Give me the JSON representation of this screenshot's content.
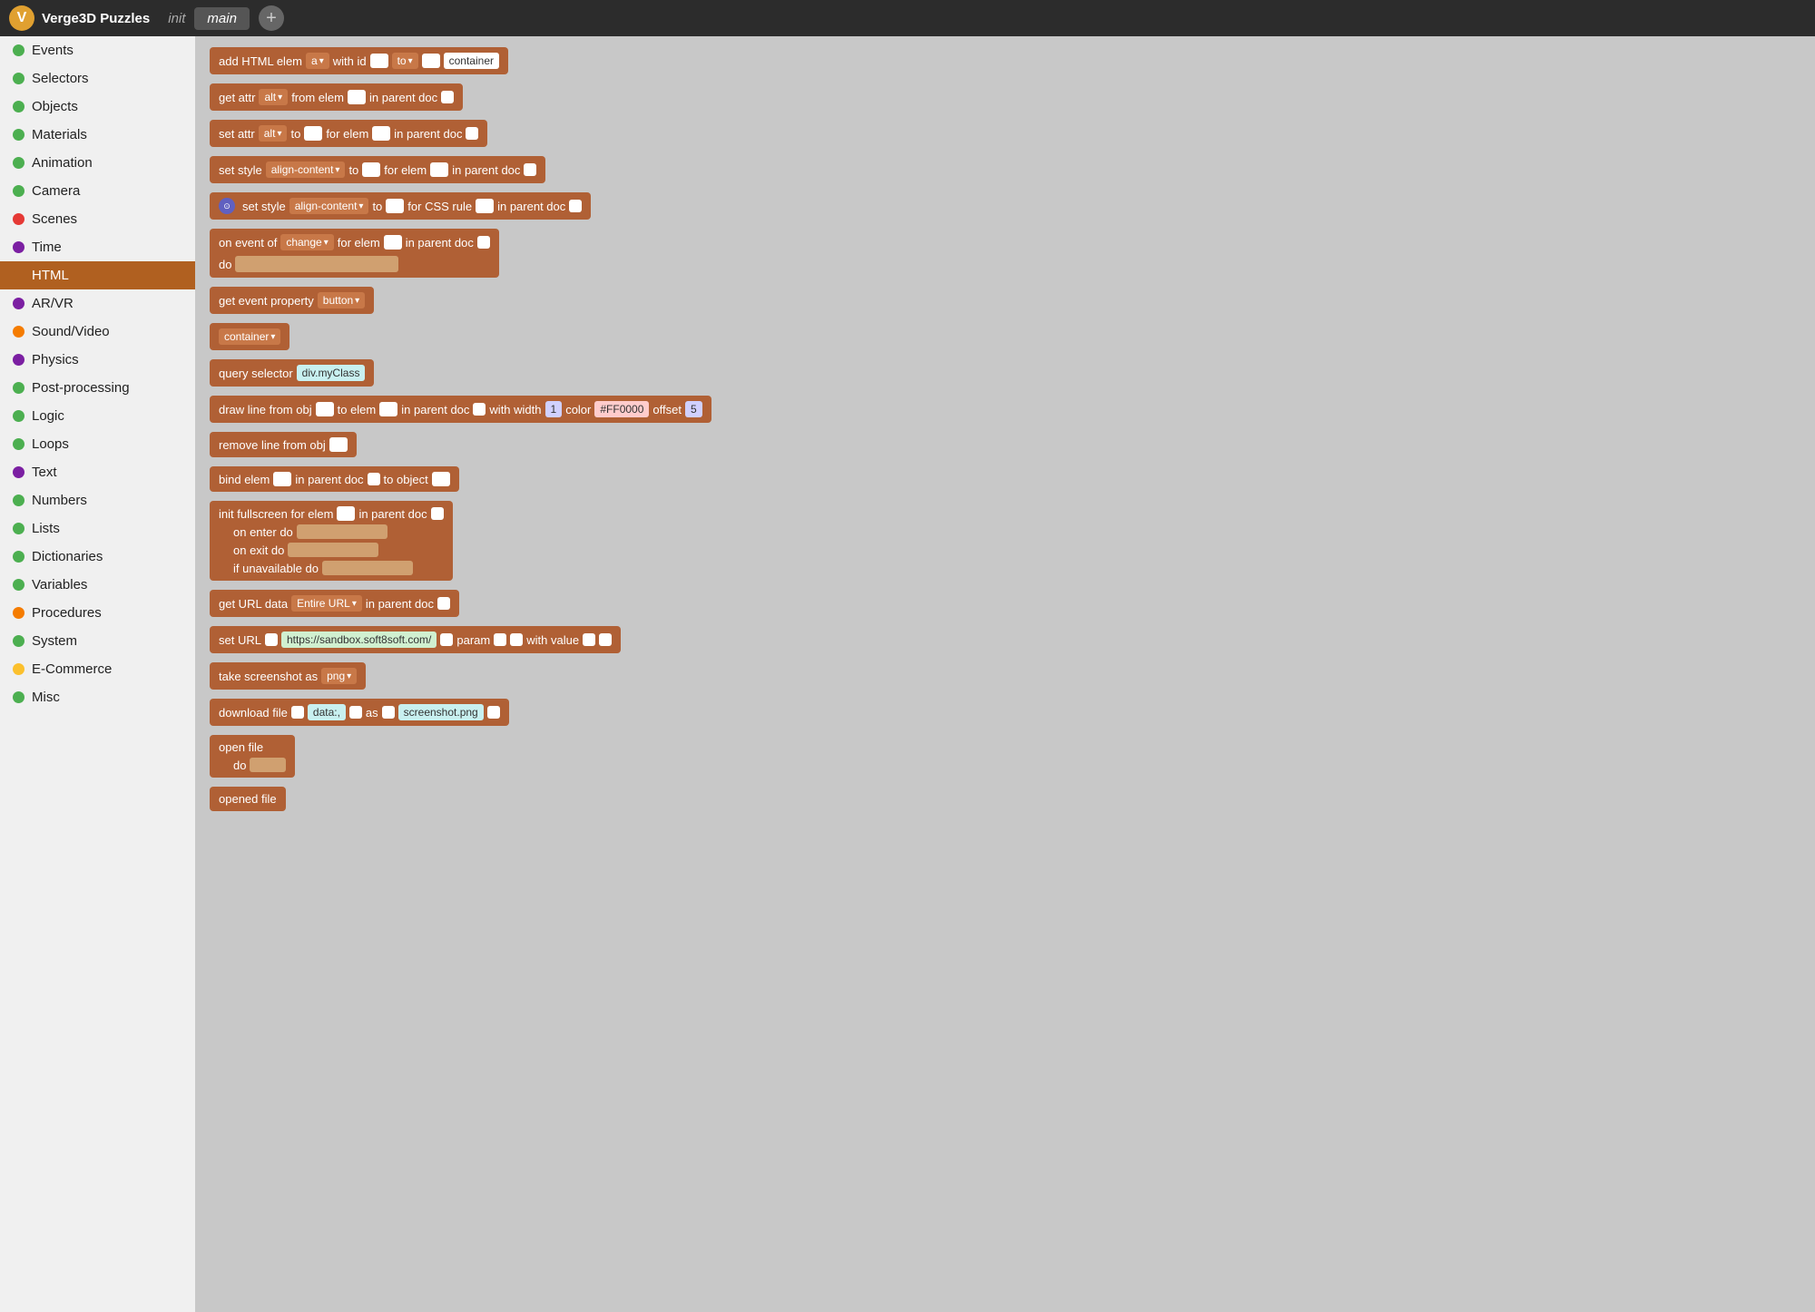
{
  "topbar": {
    "logo_icon": "V",
    "app_name": "Verge3D Puzzles",
    "tab_init": "init",
    "tab_main": "main",
    "add_tab_label": "+"
  },
  "sidebar": {
    "items": [
      {
        "id": "events",
        "label": "Events",
        "color": "#4caf50",
        "active": false
      },
      {
        "id": "selectors",
        "label": "Selectors",
        "color": "#4caf50",
        "active": false
      },
      {
        "id": "objects",
        "label": "Objects",
        "color": "#4caf50",
        "active": false
      },
      {
        "id": "materials",
        "label": "Materials",
        "color": "#4caf50",
        "active": false
      },
      {
        "id": "animation",
        "label": "Animation",
        "color": "#4caf50",
        "active": false
      },
      {
        "id": "camera",
        "label": "Camera",
        "color": "#4caf50",
        "active": false
      },
      {
        "id": "scenes",
        "label": "Scenes",
        "color": "#e53935",
        "active": false
      },
      {
        "id": "time",
        "label": "Time",
        "color": "#7b1fa2",
        "active": false
      },
      {
        "id": "html",
        "label": "HTML",
        "color": "#b06020",
        "active": true
      },
      {
        "id": "arvr",
        "label": "AR/VR",
        "color": "#7b1fa2",
        "active": false
      },
      {
        "id": "sound-video",
        "label": "Sound/Video",
        "color": "#f57c00",
        "active": false
      },
      {
        "id": "physics",
        "label": "Physics",
        "color": "#7b1fa2",
        "active": false
      },
      {
        "id": "post-processing",
        "label": "Post-processing",
        "color": "#4caf50",
        "active": false
      },
      {
        "id": "logic",
        "label": "Logic",
        "color": "#4caf50",
        "active": false
      },
      {
        "id": "loops",
        "label": "Loops",
        "color": "#4caf50",
        "active": false
      },
      {
        "id": "text",
        "label": "Text",
        "color": "#7b1fa2",
        "active": false
      },
      {
        "id": "numbers",
        "label": "Numbers",
        "color": "#4caf50",
        "active": false
      },
      {
        "id": "lists",
        "label": "Lists",
        "color": "#4caf50",
        "active": false
      },
      {
        "id": "dictionaries",
        "label": "Dictionaries",
        "color": "#4caf50",
        "active": false
      },
      {
        "id": "variables",
        "label": "Variables",
        "color": "#4caf50",
        "active": false
      },
      {
        "id": "procedures",
        "label": "Procedures",
        "color": "#f57c00",
        "active": false
      },
      {
        "id": "system",
        "label": "System",
        "color": "#4caf50",
        "active": false
      },
      {
        "id": "e-commerce",
        "label": "E-Commerce",
        "color": "#fbc02d",
        "active": false
      },
      {
        "id": "misc",
        "label": "Misc",
        "color": "#4caf50",
        "active": false
      }
    ]
  },
  "blocks": {
    "b1": "add HTML elem",
    "b1_drop": "a",
    "b1_text1": "with id",
    "b1_drop2": "to",
    "b1_input": "container",
    "b2": "get attr",
    "b2_drop": "alt",
    "b2_text1": "from elem",
    "b2_text2": "in parent doc",
    "b3": "set attr",
    "b3_drop": "alt",
    "b3_text1": "to",
    "b3_text2": "for elem",
    "b3_text3": "in parent doc",
    "b4": "set style",
    "b4_drop": "align-content",
    "b4_text1": "to",
    "b4_text2": "for elem",
    "b4_text3": "in parent doc",
    "b5": "set style",
    "b5_drop": "align-content",
    "b5_text1": "to",
    "b5_text2": "for CSS rule",
    "b5_text3": "in parent doc",
    "b6": "on event of",
    "b6_drop": "change",
    "b6_text1": "for elem",
    "b6_text2": "in parent doc",
    "b6_do": "do",
    "b7": "get event property",
    "b7_drop": "button",
    "b8_label": "container",
    "b9": "query selector",
    "b9_input": "div.myClass",
    "b10": "draw line from obj",
    "b10_text1": "to elem",
    "b10_text2": "in parent doc",
    "b10_text3": "with width",
    "b10_num": "1",
    "b10_text4": "color",
    "b10_color": "#FF0000",
    "b10_text5": "offset",
    "b10_offset": "5",
    "b11": "remove line from obj",
    "b12": "bind elem",
    "b12_text1": "in parent doc",
    "b12_text2": "to object",
    "b13": "init fullscreen for elem",
    "b13_text1": "in parent doc",
    "b13_enter": "on enter do",
    "b13_exit": "on exit do",
    "b13_unavail": "if unavailable do",
    "b14": "get URL data",
    "b14_drop": "Entire URL",
    "b14_text1": "in parent doc",
    "b15": "set URL",
    "b15_url": "https://sandbox.soft8soft.com/",
    "b15_text1": "param",
    "b15_text2": "with value",
    "b16": "take screenshot as",
    "b16_drop": "png",
    "b17": "download file",
    "b17_text1": "data:,",
    "b17_text2": "as",
    "b17_text3": "screenshot.png",
    "b18": "open file",
    "b18_do": "do",
    "b19": "opened file"
  }
}
